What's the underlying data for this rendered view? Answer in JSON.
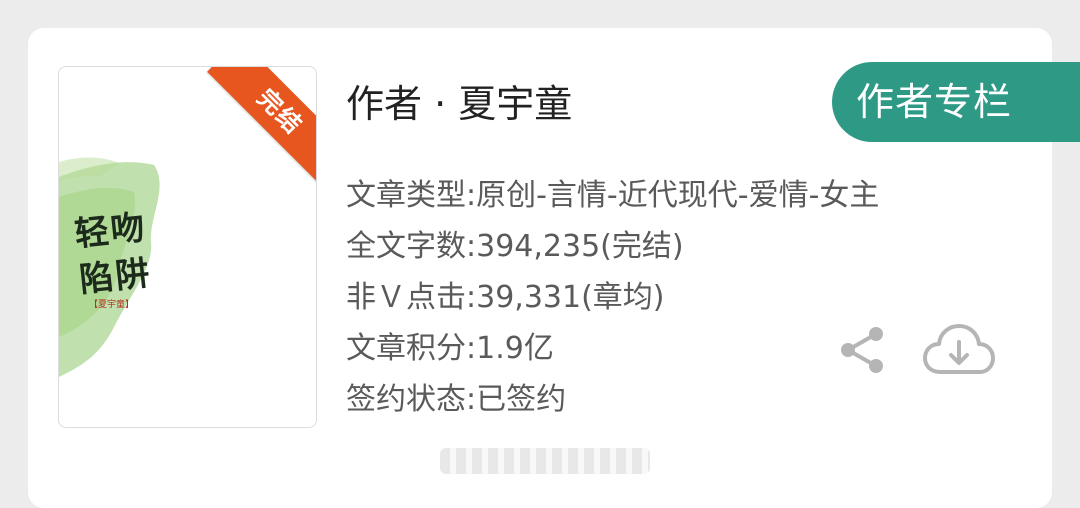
{
  "book": {
    "cover_title_line1": "轻吻",
    "cover_title_line2": "陷阱",
    "cover_author": "【夏宇童】",
    "status_ribbon": "完结",
    "accent_color": "#e8561f",
    "cover_wash_color": "#8cc76a"
  },
  "author": {
    "title": "作者 · 夏宇童",
    "column_button": "作者专栏",
    "button_color": "#2e9a85"
  },
  "info_rows": [
    "文章类型:原创-言情-近代现代-爱情-女主",
    "全文字数:394,235(完结)",
    "非Ｖ点击:39,331(章均)",
    "文章积分:1.9亿",
    "签约状态:已签约"
  ],
  "icons": {
    "share": "share-icon",
    "download": "cloud-download-icon"
  }
}
